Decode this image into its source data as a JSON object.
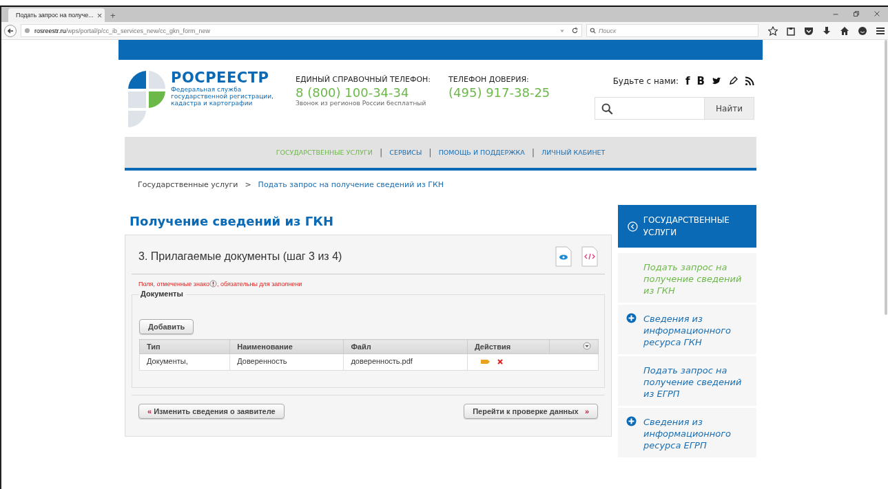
{
  "browser": {
    "tab_title": "Подать запрос на получе...",
    "tab_close": "×",
    "new_tab": "+",
    "url_domain": "rosreestr.ru",
    "url_path": "/wps/portal/p/cc_ib_services_new/cc_gkn_form_new",
    "search_placeholder": "Поиск"
  },
  "header": {
    "logo_title": "РОСРЕЕСТР",
    "logo_subtitle": "Федеральная служба государственной регистрации, кадастра и картографии",
    "phones": [
      {
        "label": "ЕДИНЫЙ СПРАВОЧНЫЙ ТЕЛЕФОН:",
        "number": "8 (800) 100-34-34",
        "note": "Звонок из регионов России бесплатный"
      },
      {
        "label": "ТЕЛЕФОН ДОВЕРИЯ:",
        "number": "(495) 917-38-25"
      }
    ],
    "social_label": "Будьте с нами:",
    "social": [
      "f",
      "В"
    ],
    "search_button": "Найти"
  },
  "nav_separator": "|",
  "nav": [
    {
      "label": "ГОСУДАРСТВЕННЫЕ УСЛУГИ",
      "selected": true
    },
    {
      "label": "СЕРВИСЫ",
      "selected": false
    },
    {
      "label": "ПОМОЩЬ И ПОДДЕРЖКА",
      "selected": false
    },
    {
      "label": "ЛИЧНЫЙ КАБИНЕТ",
      "selected": false
    }
  ],
  "breadcrumb": {
    "items": [
      "Государственные услуги",
      "Подать запрос на получение сведений из ГКН"
    ],
    "separator": ">"
  },
  "page_title": "Получение сведений из ГКН",
  "form": {
    "step_title": "3. Прилагаемые документы (шаг 3 из 4)",
    "required_note_before": "Поля, отмеченные знако",
    "required_note_after": ", обязательны для заполнени",
    "section_title": "Документы",
    "add_button": "Добавить",
    "table": {
      "columns": [
        "Тип",
        "Наименование",
        "Файл",
        "Действия"
      ],
      "rows": [
        [
          "Документы,",
          "Доверенность",
          "доверенность.pdf"
        ]
      ]
    },
    "back_button": {
      "icon": "«",
      "label": "Изменить сведения о заявителе"
    },
    "next_button": {
      "label": "Перейти к проверке данных",
      "icon": "»"
    }
  },
  "sidebar": {
    "title": "ГОСУДАРСТВЕННЫЕ УСЛУГИ",
    "items": [
      {
        "label": "Подать запрос на получение сведений из ГКН",
        "kind": "link",
        "selected": true
      },
      {
        "label": "Сведения из информационного ресурса ГКН",
        "kind": "expandable",
        "selected": false
      },
      {
        "label": "Подать запрос на получение сведений из ЕГРП",
        "kind": "link",
        "selected": false
      },
      {
        "label": "Сведения из информационного ресурса ЕГРП",
        "kind": "expandable",
        "selected": false
      }
    ]
  }
}
